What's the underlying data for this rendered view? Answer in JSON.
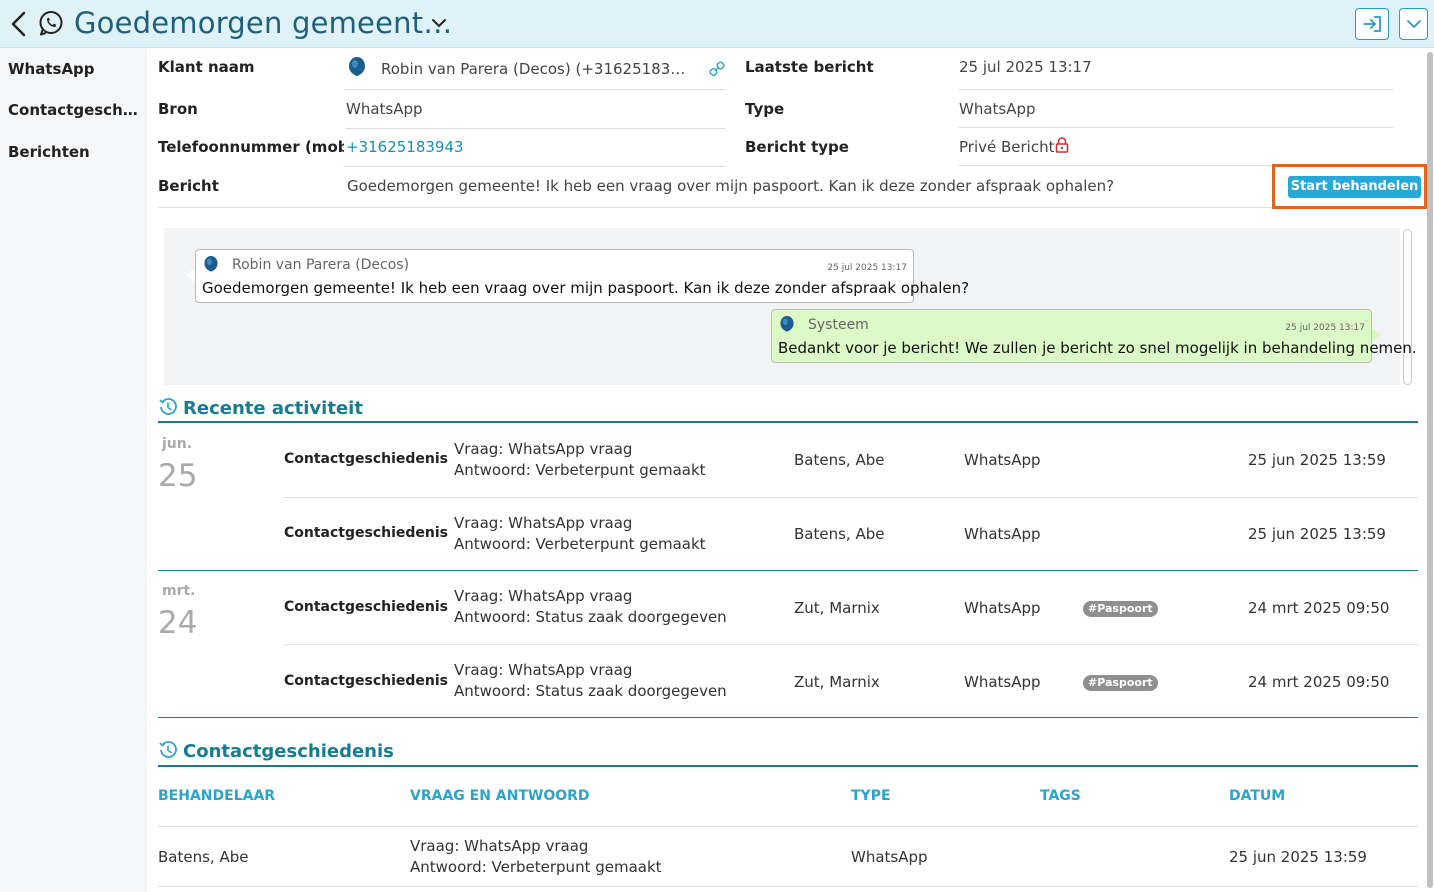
{
  "header": {
    "title": "Goedemorgen gemeent…",
    "icons": {
      "back": "chevron-left-icon",
      "channel": "whatsapp-icon",
      "caret": "chevron-down-icon",
      "exit": "exit-icon",
      "more": "chevron-down-icon"
    }
  },
  "sidebar": {
    "items": [
      {
        "label": "WhatsApp"
      },
      {
        "label": "Contactgeschiedenis"
      },
      {
        "label": "Berichten"
      }
    ]
  },
  "details": {
    "klant_label": "Klant naam",
    "klant_value": "Robin van Parera (Decos) (+31625183…",
    "laatste_label": "Laatste bericht",
    "laatste_value": "25 jul 2025 13:17",
    "bron_label": "Bron",
    "bron_value": "WhatsApp",
    "type_label": "Type",
    "type_value": "WhatsApp",
    "tel_label": "Telefoonnummer (mob…",
    "tel_value": "+31625183943",
    "berichttype_label": "Bericht type",
    "berichttype_value": "Privé Bericht",
    "bericht_label": "Bericht",
    "bericht_value": "Goedemorgen gemeente! Ik heb een vraag over mijn paspoort. Kan ik deze zonder afspraak ophalen?",
    "start_button": "Start behandelen",
    "accent_color": "#1a7a92",
    "highlight_color": "#e2641e"
  },
  "chat": {
    "messages": [
      {
        "sender": "Robin van Parera (Decos)",
        "time": "25 jul 2025 13:17",
        "text": "Goedemorgen gemeente! Ik heb een vraag over mijn paspoort. Kan ik deze zonder afspraak ophalen?"
      },
      {
        "sender": "Systeem",
        "time": "25 jul 2025 13:17",
        "text": "Bedankt voor je bericht! We zullen je bericht zo snel mogelijk in behandeling nemen."
      }
    ]
  },
  "recent": {
    "title": "Recente activiteit",
    "groups": [
      {
        "month": "jun.",
        "day": "25",
        "rows": [
          {
            "kind": "Contactgeschiedenis",
            "vraag": "Vraag: WhatsApp vraag",
            "antwoord": "Antwoord: Verbeterpunt gemaakt",
            "person": "Batens, Abe",
            "channel": "WhatsApp",
            "tag": "",
            "date": "25 jun 2025 13:59"
          },
          {
            "kind": "Contactgeschiedenis",
            "vraag": "Vraag: WhatsApp vraag",
            "antwoord": "Antwoord: Verbeterpunt gemaakt",
            "person": "Batens, Abe",
            "channel": "WhatsApp",
            "tag": "",
            "date": "25 jun 2025 13:59"
          }
        ]
      },
      {
        "month": "mrt.",
        "day": "24",
        "rows": [
          {
            "kind": "Contactgeschiedenis",
            "vraag": "Vraag: WhatsApp vraag",
            "antwoord": "Antwoord: Status zaak doorgegeven",
            "person": "Zut, Marnix",
            "channel": "WhatsApp",
            "tag": "#Paspoort",
            "date": "24 mrt 2025 09:50"
          },
          {
            "kind": "Contactgeschiedenis",
            "vraag": "Vraag: WhatsApp vraag",
            "antwoord": "Antwoord: Status zaak doorgegeven",
            "person": "Zut, Marnix",
            "channel": "WhatsApp",
            "tag": "#Paspoort",
            "date": "24 mrt 2025 09:50"
          }
        ]
      }
    ]
  },
  "history": {
    "title": "Contactgeschiedenis",
    "columns": [
      "BEHANDELAAR",
      "VRAAG EN ANTWOORD",
      "TYPE",
      "TAGS",
      "DATUM"
    ],
    "rows": [
      {
        "behandelaar": "Batens, Abe",
        "vraag": "Vraag: WhatsApp vraag",
        "antwoord": "Antwoord: Verbeterpunt gemaakt",
        "type": "WhatsApp",
        "tags": "",
        "datum": "25 jun 2025 13:59"
      }
    ]
  }
}
